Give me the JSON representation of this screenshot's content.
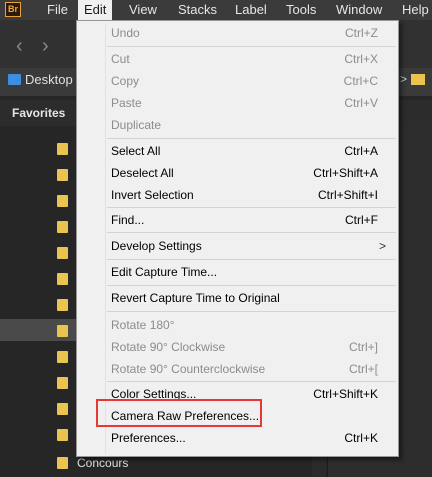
{
  "app": {
    "icon_text": "Br"
  },
  "menubar": {
    "items": [
      "File",
      "Edit",
      "View",
      "Stacks",
      "Label",
      "Tools",
      "Window",
      "Help"
    ]
  },
  "path": {
    "location": "Desktop",
    "separator": ">"
  },
  "panel": {
    "tab": "Favorites",
    "visible_folder": "Concours"
  },
  "edit_menu": {
    "undo": {
      "label": "Undo",
      "shortcut": "Ctrl+Z"
    },
    "cut": {
      "label": "Cut",
      "shortcut": "Ctrl+X"
    },
    "copy": {
      "label": "Copy",
      "shortcut": "Ctrl+C"
    },
    "paste": {
      "label": "Paste",
      "shortcut": "Ctrl+V"
    },
    "duplicate": {
      "label": "Duplicate"
    },
    "select_all": {
      "label": "Select All",
      "shortcut": "Ctrl+A"
    },
    "deselect_all": {
      "label": "Deselect All",
      "shortcut": "Ctrl+Shift+A"
    },
    "invert_selection": {
      "label": "Invert Selection",
      "shortcut": "Ctrl+Shift+I"
    },
    "find": {
      "label": "Find...",
      "shortcut": "Ctrl+F"
    },
    "develop_settings": {
      "label": "Develop Settings",
      "arrow": ">"
    },
    "edit_capture_time": {
      "label": "Edit Capture Time..."
    },
    "revert_capture_time": {
      "label": "Revert Capture Time to Original"
    },
    "rotate_180": {
      "label": "Rotate 180°"
    },
    "rotate_cw": {
      "label": "Rotate 90° Clockwise",
      "shortcut": "Ctrl+]"
    },
    "rotate_ccw": {
      "label": "Rotate 90° Counterclockwise",
      "shortcut": "Ctrl+["
    },
    "color_settings": {
      "label": "Color Settings...",
      "shortcut": "Ctrl+Shift+K"
    },
    "camera_raw_prefs": {
      "label": "Camera Raw Preferences..."
    },
    "preferences": {
      "label": "Preferences...",
      "shortcut": "Ctrl+K"
    }
  },
  "colors": {
    "highlight": "#e53936",
    "folder": "#e9c44f",
    "desktop_folder": "#3d8de0"
  }
}
